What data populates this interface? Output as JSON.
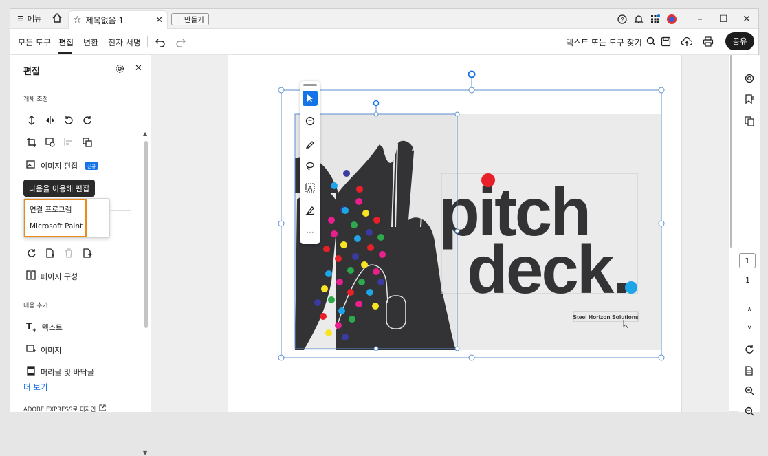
{
  "titlebar": {
    "menu_label": "메뉴",
    "tab_title": "제목없음 1",
    "new_tab_label": "만들기"
  },
  "toolbar": {
    "tabs": [
      {
        "label": "모든 도구"
      },
      {
        "label": "편집"
      },
      {
        "label": "변환"
      },
      {
        "label": "전자 서명"
      }
    ],
    "search_label": "텍스트 또는 도구 찾기",
    "share_label": "공유"
  },
  "panel": {
    "title": "편집",
    "section_object": "개체 조정",
    "edit_image_label": "이미지 편집",
    "new_badge": "신규",
    "tooltip": "다음을 이용해 편집",
    "popup_options": [
      "연결 프로그램",
      "Microsoft Paint"
    ],
    "page_organize_label": "페이지 구성",
    "section_add": "내용 추가",
    "add_items": [
      {
        "label": "텍스트"
      },
      {
        "label": "이미지"
      },
      {
        "label": "머리글 및 바닥글"
      }
    ],
    "more_label": "더 보기",
    "adobe_express_label": "ADOBE EXPRESS로 디자인"
  },
  "document": {
    "word1": "pitch",
    "word2": "deck.",
    "company": "Steel Horizon Solutions"
  },
  "pagination": {
    "current": "1",
    "total": "1"
  },
  "colors": {
    "accent": "#1473e6",
    "highlight": "#e88b1d",
    "hand": "#333336",
    "dot_red": "#e8202a",
    "dot_blue": "#1ea5e8"
  }
}
